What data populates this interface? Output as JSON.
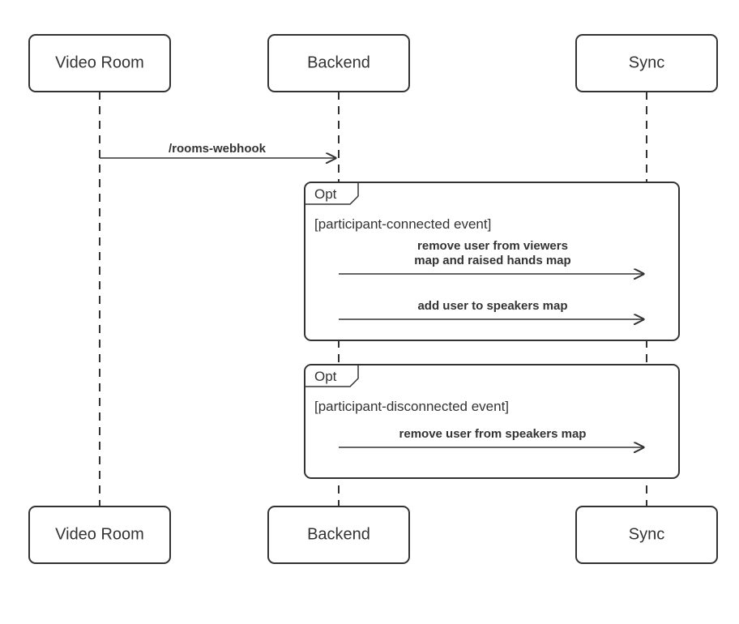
{
  "participants": {
    "a": "Video Room",
    "b": "Backend",
    "c": "Sync"
  },
  "messages": {
    "webhook": "/rooms-webhook",
    "opt1_guard": "[participant-connected event]",
    "opt1_msg1_l1": "remove user from viewers",
    "opt1_msg1_l2": "map and raised hands map",
    "opt1_msg2": "add user to speakers map",
    "opt2_guard": "[participant-disconnected event]",
    "opt2_msg1": "remove user from speakers map"
  },
  "frame_label": "Opt"
}
